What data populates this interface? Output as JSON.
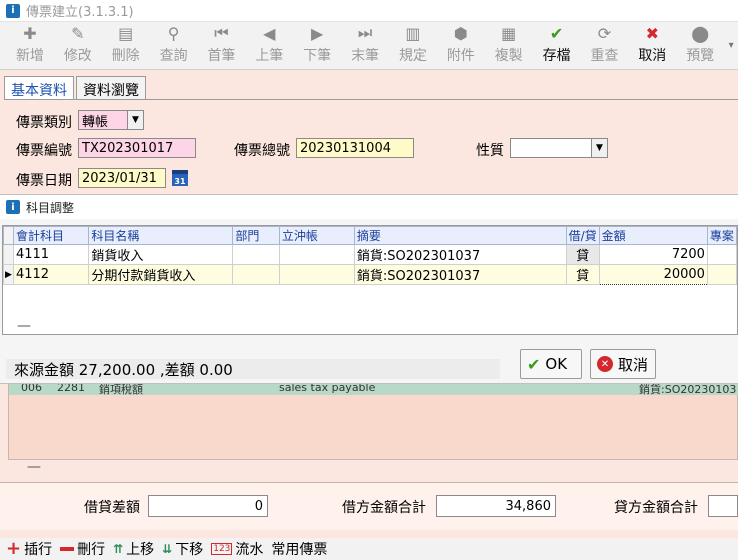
{
  "window": {
    "title": "傳票建立(3.1.3.1)"
  },
  "toolbar": [
    {
      "label": "新增",
      "icon": "new-icon",
      "active": false
    },
    {
      "label": "修改",
      "icon": "edit-icon",
      "active": false
    },
    {
      "label": "刪除",
      "icon": "delete-icon",
      "active": false
    },
    {
      "label": "查詢",
      "icon": "search-icon",
      "active": false
    },
    {
      "label": "首筆",
      "icon": "first-icon",
      "active": false
    },
    {
      "label": "上筆",
      "icon": "prev-icon",
      "active": false
    },
    {
      "label": "下筆",
      "icon": "next-icon",
      "active": false
    },
    {
      "label": "末筆",
      "icon": "last-icon",
      "active": false
    },
    {
      "label": "規定",
      "icon": "book-icon",
      "active": false
    },
    {
      "label": "附件",
      "icon": "attach-icon",
      "active": false
    },
    {
      "label": "複製",
      "icon": "copy-icon",
      "active": false
    },
    {
      "label": "存檔",
      "icon": "save-icon",
      "active": true
    },
    {
      "label": "重查",
      "icon": "refresh-icon",
      "active": false
    },
    {
      "label": "取消",
      "icon": "cancel-icon",
      "active": true
    },
    {
      "label": "預覽",
      "icon": "preview-icon",
      "active": false
    }
  ],
  "tabs": {
    "basic": "基本資料",
    "browse": "資料瀏覽"
  },
  "form": {
    "type_label": "傳票類別",
    "type_value": "轉帳",
    "no_label": "傳票編號",
    "no_value": "TX202301017",
    "total_no_label": "傳票總號",
    "total_no_value": "20230131004",
    "nature_label": "性質",
    "nature_value": "",
    "date_label": "傳票日期",
    "date_value": "2023/01/31",
    "cal_text": "31"
  },
  "dialog": {
    "title": "科目調整",
    "columns": [
      "會計科目",
      "科目名稱",
      "部門",
      "立沖帳",
      "摘要",
      "借/貸",
      "金額",
      "專案"
    ],
    "rows": [
      {
        "code": "4111",
        "name": "銷貨收入",
        "dept": "",
        "offset": "",
        "summary": "銷貨:SO202301037",
        "dc": "貸",
        "amount": "7200",
        "project": ""
      },
      {
        "code": "4112",
        "name": "分期付款銷貨收入",
        "dept": "",
        "offset": "",
        "summary": "銷貨:SO202301037",
        "dc": "貸",
        "amount": "20000",
        "project": ""
      }
    ],
    "footer_text": "來源金額 27,200.00 ,差額 0.00",
    "ok_label": "OK",
    "cancel_label": "取消",
    "dash": "—"
  },
  "under_row": {
    "seq": "006",
    "code": "2281",
    "name": "銷項稅額",
    "english": "sales tax payable",
    "summary": "銷貨:SO20230103"
  },
  "totals": {
    "diff_label": "借貸差額",
    "diff_value": "0",
    "debit_label": "借方金額合計",
    "debit_value": "34,860",
    "credit_label": "貸方金額合計",
    "credit_value": ""
  },
  "bottom": {
    "insert": "插行",
    "delete": "刪行",
    "up": "上移",
    "down": "下移",
    "flow": "流水",
    "common": "常用傳票",
    "up_glyph": "⇈",
    "down_glyph": "⇊",
    "num_glyph": "123"
  }
}
